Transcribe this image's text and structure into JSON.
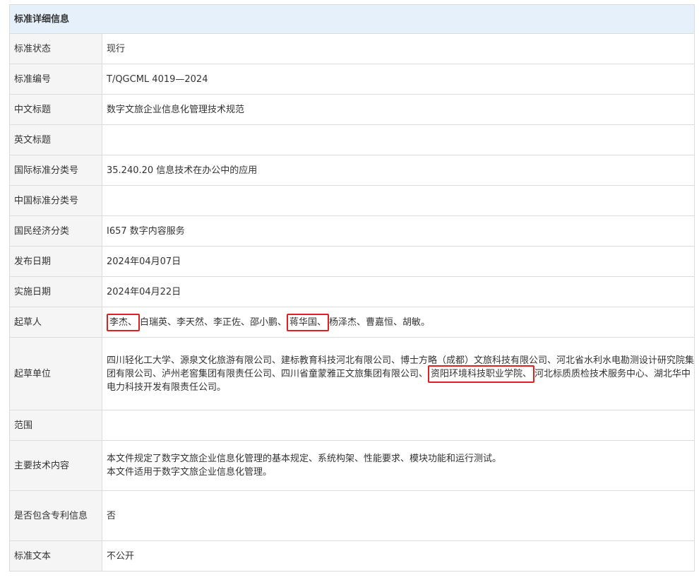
{
  "header": {
    "title": "标准详细信息"
  },
  "rows": {
    "status": {
      "label": "标准状态",
      "value": "现行"
    },
    "number": {
      "label": "标准编号",
      "value": "T/QGCML 4019—2024"
    },
    "cn_title": {
      "label": "中文标题",
      "value": "数字文旅企业信息化管理技术规范"
    },
    "en_title": {
      "label": "英文标题",
      "value": ""
    },
    "ics": {
      "label": "国际标准分类号",
      "value": "35.240.20 信息技术在办公中的应用"
    },
    "ccs": {
      "label": "中国标准分类号",
      "value": ""
    },
    "economy": {
      "label": "国民经济分类",
      "value": "I657 数字内容服务"
    },
    "publish": {
      "label": "发布日期",
      "value": "2024年04月07日"
    },
    "implement": {
      "label": "实施日期",
      "value": "2024年04月22日"
    },
    "drafters": {
      "label": "起草人",
      "items": [
        "李杰、",
        "白瑞英、李天然、李正佐、邵小鹏、",
        "蒋华国、",
        "杨泽杰、曹嘉恒、胡敏。"
      ]
    },
    "units": {
      "label": "起草单位",
      "part1": "四川轻化工大学、源泉文化旅游有限公司、建标教育科技河北有限公司、博士方略（成都）文旅科技有限公司、河北省水利水电勘测设计研究院集团有限公司、泸州老窖集团有限责任公司、四川省童蒙雅正文旅集团有限公司、",
      "highlight": "资阳环境科技职业学院、",
      "part2": "河北标质质检技术服务中心、湖北华中电力科技开发有限责任公司。"
    },
    "scope": {
      "label": "范围",
      "value": ""
    },
    "content": {
      "label": "主要技术内容",
      "line1": "本文件规定了数字文旅企业信息化管理的基本规定、系统构架、性能要求、模块功能和运行测试。",
      "line2": "本文件适用于数字文旅企业信息化管理。"
    },
    "patent": {
      "label": "是否包含专利信息",
      "value": "否"
    },
    "text": {
      "label": "标准文本",
      "value": "不公开"
    }
  },
  "colors": {
    "header_bg": "#e6f0fb",
    "label_bg": "#f5f5f5",
    "border": "#dcdcdc",
    "highlight": "#e02020"
  }
}
